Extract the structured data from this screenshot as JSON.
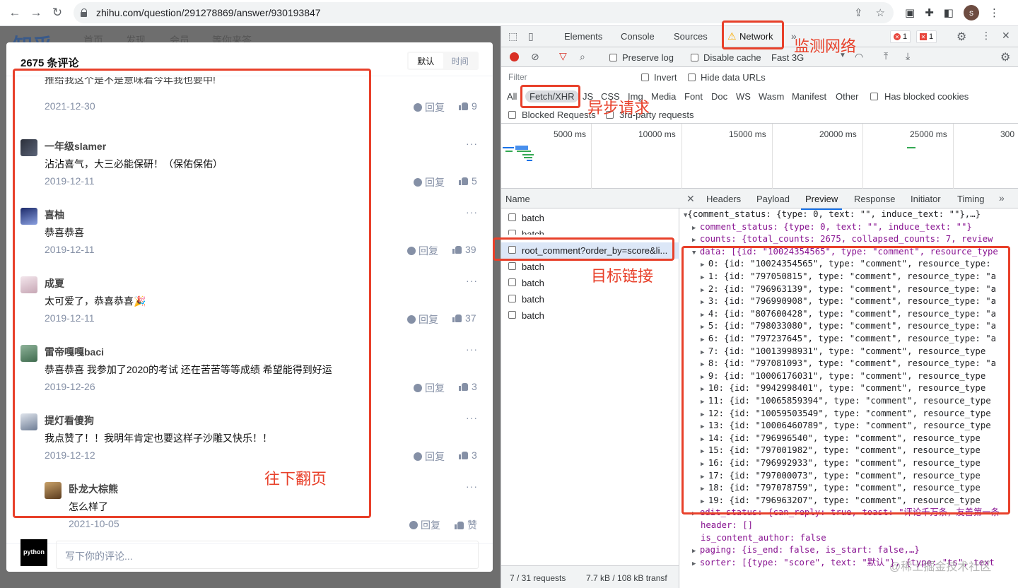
{
  "browser": {
    "url": "zhihu.com/question/291278869/answer/930193847",
    "profile_initial": "s"
  },
  "zhihu": {
    "logo": "知乎",
    "nav": [
      "首页",
      "发现",
      "会员",
      "等你来答"
    ],
    "comment_count": "2675 条评论",
    "sort": {
      "default": "默认",
      "time": "时间"
    },
    "reply_label": "回复",
    "input_placeholder": "写下你的评论...",
    "footer_avatar_text": "python",
    "comments": [
      {
        "name": "",
        "text": "推给我这个是不是意味着今年我也要中!",
        "date": "2021-12-30",
        "likes": "9"
      },
      {
        "name": "一年级slamer",
        "text": "沾沾喜气，大三必能保研！（保佑保佑）",
        "date": "2019-12-11",
        "likes": "5"
      },
      {
        "name": "喜柚",
        "text": "恭喜恭喜",
        "date": "2019-12-11",
        "likes": "39"
      },
      {
        "name": "成夏",
        "text": "太可爱了，恭喜恭喜🎉",
        "date": "2019-12-11",
        "likes": "37"
      },
      {
        "name": "雷帝嘎嘎baci",
        "text": "恭喜恭喜 我参加了2020的考试 还在苦苦等等成绩 希望能得到好运",
        "date": "2019-12-26",
        "likes": "3"
      },
      {
        "name": "提灯看傻狗",
        "text": "我点赞了！！我明年肯定也要这样子沙雕又快乐！！",
        "date": "2019-12-12",
        "likes": "3"
      },
      {
        "name": "卧龙大棕熊",
        "text": "怎么样了",
        "date": "2021-10-05",
        "likes": "赞"
      }
    ]
  },
  "devtools": {
    "tabs": [
      "Elements",
      "Console",
      "Sources",
      "Network"
    ],
    "error_count": "1",
    "issue_count": "1",
    "toolbar": {
      "preserve_log": "Preserve log",
      "disable_cache": "Disable cache",
      "throttle": "Fast 3G"
    },
    "filter_placeholder": "Filter",
    "invert": "Invert",
    "hide_data_urls": "Hide data URLs",
    "types": [
      "All",
      "Fetch/XHR",
      "JS",
      "CSS",
      "Img",
      "Media",
      "Font",
      "Doc",
      "WS",
      "Wasm",
      "Manifest",
      "Other"
    ],
    "has_blocked_cookies": "Has blocked cookies",
    "blocked_requests": "Blocked Requests",
    "third_party": "3rd-party requests",
    "timeline_labels": [
      "5000 ms",
      "10000 ms",
      "15000 ms",
      "20000 ms",
      "25000 ms",
      "300"
    ],
    "name_header": "Name",
    "requests": [
      "batch",
      "batch",
      "root_comment?order_by=score&li...",
      "batch",
      "batch",
      "batch",
      "batch"
    ],
    "detail_tabs": [
      "Headers",
      "Payload",
      "Preview",
      "Response",
      "Initiator",
      "Timing"
    ],
    "status": {
      "requests": "7 / 31 requests",
      "transferred": "7.7 kB / 108 kB transf"
    },
    "preview": {
      "root": "{comment_status: {type: 0, text: \"\", induce_text: \"\"},…}",
      "comment_status": "comment_status: {type: 0, text: \"\", induce_text: \"\"}",
      "counts": "counts: {total_counts: 2675, collapsed_counts: 7, review",
      "data": "data: [{id: \"10024354565\", type: \"comment\", resource_type",
      "items": [
        "0: {id: \"10024354565\", type: \"comment\", resource_type:",
        "1: {id: \"797050815\", type: \"comment\", resource_type: \"a",
        "2: {id: \"796963139\", type: \"comment\", resource_type: \"a",
        "3: {id: \"796990908\", type: \"comment\", resource_type: \"a",
        "4: {id: \"807600428\", type: \"comment\", resource_type: \"a",
        "5: {id: \"798033080\", type: \"comment\", resource_type: \"a",
        "6: {id: \"797237645\", type: \"comment\", resource_type: \"a",
        "7: {id: \"10013998931\", type: \"comment\", resource_type",
        "8: {id: \"797081093\", type: \"comment\", resource_type: \"a",
        "9: {id: \"10006176031\", type: \"comment\", resource_type",
        "10: {id: \"9942998401\", type: \"comment\", resource_type",
        "11: {id: \"10065859394\", type: \"comment\", resource_type",
        "12: {id: \"10059503549\", type: \"comment\", resource_type",
        "13: {id: \"10006460789\", type: \"comment\", resource_type",
        "14: {id: \"796996540\", type: \"comment\", resource_type",
        "15: {id: \"797001982\", type: \"comment\", resource_type",
        "16: {id: \"796992933\", type: \"comment\", resource_type",
        "17: {id: \"797000073\", type: \"comment\", resource_type",
        "18: {id: \"797078759\", type: \"comment\", resource_type",
        "19: {id: \"796963207\", type: \"comment\", resource_type"
      ],
      "edit_status": "edit_status: {can_reply: true, toast: \"评论千万条，友善第一条",
      "header": "header: []",
      "is_content_author": "is_content_author: false",
      "paging": "paging: {is_end: false, is_start: false,…}",
      "sorter": "sorter: [{type: \"score\", text: \"默认\"}, {type: \"ts\", text"
    }
  },
  "annotations": {
    "network": "监测网络",
    "async": "异步请求",
    "target": "目标链接",
    "scroll": "往下翻页",
    "color": "#e8402a"
  },
  "watermark": "@稀土掘金技术社区"
}
